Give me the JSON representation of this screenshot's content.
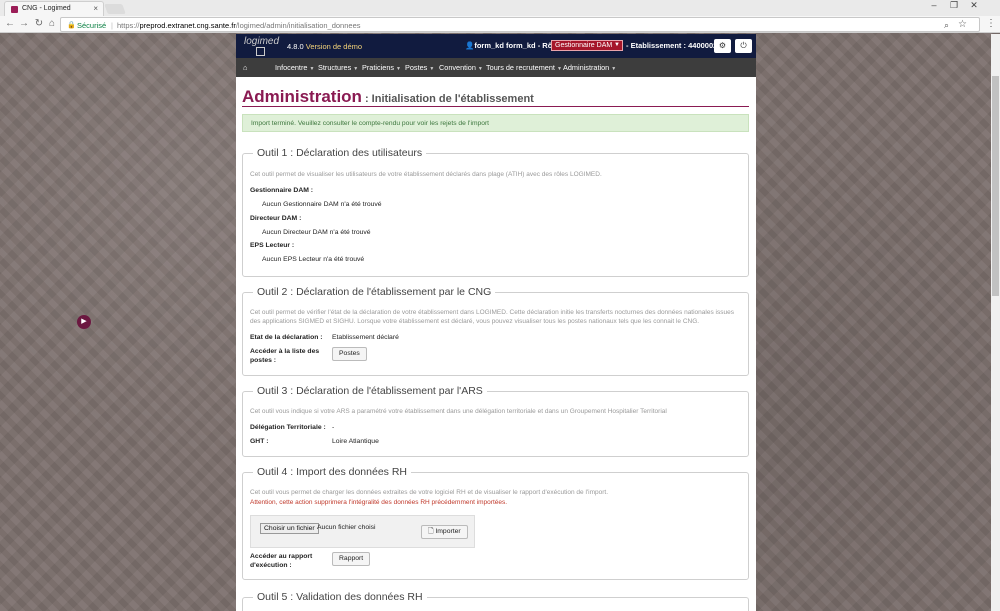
{
  "browser": {
    "tab_title": "CNG - Logimed",
    "secure_label": "Sécurisé",
    "url_scheme": "https://",
    "url_host": "preprod.extranet.cng.sante.fr",
    "url_path": "/logimed/admin/initialisation_donnees"
  },
  "header": {
    "logo_text": "logimed",
    "version": "4.8.0",
    "version_tag": "Version de démo",
    "user": "form_kd form_kd",
    "role_label": "- Rôle :",
    "role_value": "Gestionnaire DAM",
    "etab_label": "- Etablissement :",
    "etab_value": "440000289"
  },
  "nav": {
    "items": [
      {
        "label": "Infocentre"
      },
      {
        "label": "Structures"
      },
      {
        "label": "Praticiens"
      },
      {
        "label": "Postes"
      },
      {
        "label": "Convention"
      },
      {
        "label": "Tours de recrutement"
      },
      {
        "label": "Administration"
      }
    ]
  },
  "page": {
    "title": "Administration",
    "subtitle": ": Initialisation de l'établissement",
    "alert": "Import terminé. Veuillez consulter le compte-rendu pour voir les rejets de l'import"
  },
  "outil1": {
    "title": "Outil 1 : Déclaration des utilisateurs",
    "desc": "Cet outil permet de visualiser les utilisateurs de votre établissement déclarés dans plage (ATIH) avec des rôles LOGIMED.",
    "gest_label": "Gestionnaire DAM :",
    "gest_value": "Aucun Gestionnaire DAM n'a été trouvé",
    "dir_label": "Directeur DAM :",
    "dir_value": "Aucun Directeur DAM n'a été trouvé",
    "eps_label": "EPS Lecteur :",
    "eps_value": "Aucun EPS Lecteur n'a été trouvé"
  },
  "outil2": {
    "title": "Outil 2 : Déclaration de l'établissement par le CNG",
    "desc": "Cet outil permet de vérifier l'état de la déclaration de votre établissement dans LOGIMED. Cette déclaration initie les transferts nocturnes des données nationales issues des applications SIGMED et SIGHU. Lorsque votre établissement est déclaré, vous pouvez visualiser tous les postes nationaux tels que les connait le CNG.",
    "etat_label": "Etat de la déclaration :",
    "etat_value": "Etablissement déclaré",
    "liste_label": "Accéder à la liste des postes :",
    "postes_btn": "Postes"
  },
  "outil3": {
    "title": "Outil 3 : Déclaration de l'établissement par l'ARS",
    "desc": "Cet outil vous indique si votre ARS a paramétré votre établissement dans une délégation territoriale et dans un Groupement Hospitalier Territorial",
    "deleg_label": "Délégation Territoriale :",
    "deleg_value": "-",
    "ght_label": "GHT :",
    "ght_value": "Loire Atlantique"
  },
  "outil4": {
    "title": "Outil 4 : Import des données RH",
    "desc": "Cet outil vous permet de charger les données extraites de votre logiciel RH et de visualiser le rapport d'exécution de l'import.",
    "warning": "Attention, cette action supprimera l'intégralité des données RH précédemment importées.",
    "file_btn": "Choisir un fichier",
    "file_none": "Aucun fichier choisi",
    "import_btn": "Importer",
    "rapport_label": "Accéder au rapport d'exécution :",
    "rapport_btn": "Rapport"
  },
  "outil5": {
    "title": "Outil 5 : Validation des données RH"
  },
  "colors": {
    "brand": "#8a1a52",
    "topbar": "#111b3f",
    "navbar": "#3d3d3d",
    "role_select": "#a5162a",
    "alert_bg": "#dff0d8"
  }
}
